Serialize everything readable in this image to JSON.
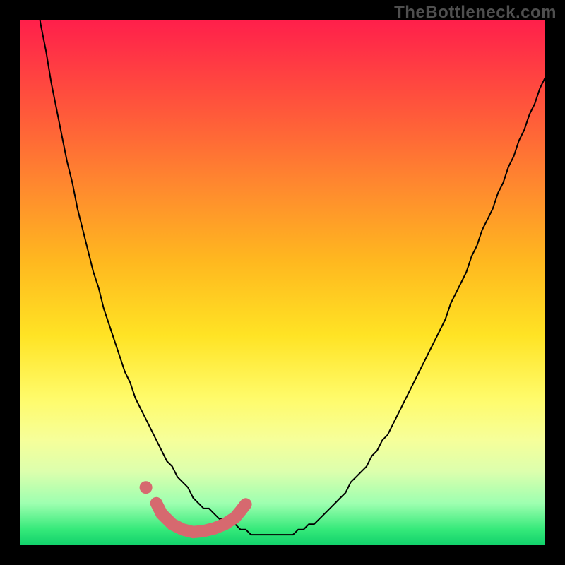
{
  "watermark": "TheBottleneck.com",
  "colors": {
    "background_frame": "#000000",
    "gradient_top": "#ff1f4b",
    "gradient_bottom": "#11d16b",
    "curve": "#000000",
    "marker": "#d6696f"
  },
  "chart_data": {
    "type": "line",
    "title": "",
    "xlabel": "",
    "ylabel": "",
    "xlim": [
      0,
      100
    ],
    "ylim": [
      0,
      100
    ],
    "x": [
      0,
      1,
      2,
      3,
      4,
      5,
      6,
      7,
      8,
      9,
      10,
      11,
      12,
      13,
      14,
      15,
      16,
      17,
      18,
      19,
      20,
      21,
      22,
      23,
      24,
      25,
      26,
      27,
      28,
      29,
      30,
      31,
      32,
      33,
      34,
      35,
      36,
      37,
      38,
      39,
      40,
      41,
      42,
      43,
      44,
      45,
      46,
      47,
      48,
      49,
      50,
      51,
      52,
      53,
      54,
      55,
      56,
      57,
      58,
      59,
      60,
      61,
      62,
      63,
      64,
      65,
      66,
      67,
      68,
      69,
      70,
      71,
      72,
      73,
      74,
      75,
      76,
      77,
      78,
      79,
      80,
      81,
      82,
      83,
      84,
      85,
      86,
      87,
      88,
      89,
      90,
      91,
      92,
      93,
      94,
      95,
      96,
      97,
      98,
      99,
      100
    ],
    "series": [
      {
        "name": "curve",
        "values": [
          124,
          118,
          111,
          105,
          99,
          94,
          88,
          83,
          78,
          73,
          69,
          64,
          60,
          56,
          52,
          49,
          45,
          42,
          39,
          36,
          33,
          31,
          28,
          26,
          24,
          22,
          20,
          18,
          16,
          15,
          13,
          12,
          11,
          9,
          8,
          7,
          7,
          6,
          5,
          5,
          4,
          4,
          3,
          3,
          2,
          2,
          2,
          2,
          2,
          2,
          2,
          2,
          2,
          3,
          3,
          4,
          4,
          5,
          6,
          7,
          8,
          9,
          10,
          12,
          13,
          14,
          15,
          17,
          18,
          20,
          21,
          23,
          25,
          27,
          29,
          31,
          33,
          35,
          37,
          39,
          41,
          43,
          46,
          48,
          50,
          52,
          55,
          57,
          60,
          62,
          64,
          67,
          69,
          72,
          74,
          77,
          79,
          82,
          84,
          87,
          89
        ]
      }
    ],
    "marker_trace": {
      "start_dot": {
        "x": 24,
        "y": 11
      },
      "path_points": [
        {
          "x": 26,
          "y": 8
        },
        {
          "x": 27,
          "y": 6
        },
        {
          "x": 29,
          "y": 4
        },
        {
          "x": 31,
          "y": 3
        },
        {
          "x": 33,
          "y": 2.5
        },
        {
          "x": 35,
          "y": 2.7
        },
        {
          "x": 37,
          "y": 3.2
        },
        {
          "x": 39,
          "y": 4
        },
        {
          "x": 41,
          "y": 5.3
        },
        {
          "x": 42,
          "y": 6.5
        },
        {
          "x": 43,
          "y": 7.8
        }
      ],
      "stroke_width": 13
    },
    "background": "rainbow-gradient",
    "legend": false,
    "grid": false
  }
}
